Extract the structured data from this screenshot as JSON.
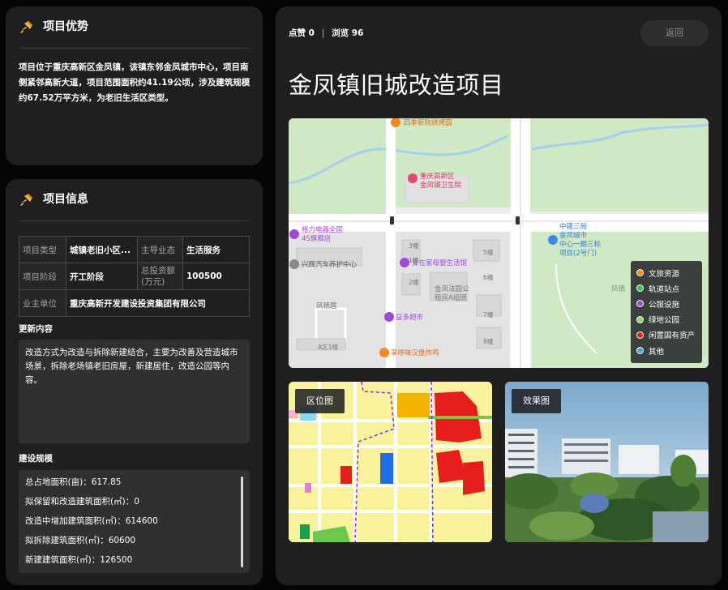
{
  "advantage": {
    "title": "项目优势",
    "text": "项目位于重庆高新区金凤镇，该镇东邻金凤城市中心，项目南侧紧邻高新大道，项目范围面积约41.19公顷，涉及建筑规模约67.52万平方米，为老旧生活区类型。"
  },
  "info": {
    "title": "项目信息",
    "type_label": "项目类型",
    "type_value": "城镇老旧小区...",
    "business_label": "主导业态",
    "business_value": "生活服务",
    "stage_label": "项目阶段",
    "stage_value": "开工阶段",
    "investment_label": "总投资额(万元)",
    "investment_value": "100500",
    "owner_label": "业主单位",
    "owner_value": "重庆高新开发建设投资集团有限公司",
    "content_label": "更新内容",
    "content_text": "改造方式为改造与拆除新建结合，主要为改善及营造城市场景，拆除老场镇老旧房屋，新建居住，改造公园等内容。",
    "scale_label": "建设规模",
    "scale_items": [
      "总占地面积(亩)：617.85",
      "拟保留和改造建筑面积(㎡)：0",
      "改造中增加建筑面积(㎡)：614600",
      "拟拆除建筑面积(㎡)：60600",
      "新建建筑面积(㎡)：126500"
    ]
  },
  "main": {
    "likes_label": "点赞",
    "likes": "0",
    "separator": "|",
    "views_label": "浏览",
    "views": "96",
    "back_label": "返回",
    "title": "金凤镇旧城改造项目"
  },
  "map": {
    "labels": {
      "top": "四季新院烧烤园",
      "hospital": "重庆高新区\n金凤镇卫生院",
      "store": "格力电器全国\n4S旗舰店",
      "metro": "中建三局\n金凤城市\n中心一期三标\n项目(2号门)",
      "auto": "兴辉汽车养护中心",
      "baby": "爱在家母婴生活馆",
      "side": "凤栖",
      "park": "金凤法园公\n租房A组团",
      "fengxi": "凤栖居",
      "super": "益多超市",
      "restaurant": "享哆味汉堡炸鸡",
      "b3": "3幢",
      "b5": "5幢",
      "b1": "1幢",
      "b2": "2幢",
      "b6": "6幢",
      "b7": "7幢",
      "b8": "8幢",
      "a1": "A区1幢"
    },
    "legend": [
      {
        "label": "文旅资源",
        "color": "#f28a1e"
      },
      {
        "label": "轨道站点",
        "color": "#3cc35a"
      },
      {
        "label": "公服设施",
        "color": "#a04ad8"
      },
      {
        "label": "绿地公园",
        "color": "#9ed55b"
      },
      {
        "label": "闲置国有资产",
        "color": "#e02323"
      },
      {
        "label": "其他",
        "color": "#4aa0e6"
      }
    ]
  },
  "thumbs": {
    "location_label": "区位图",
    "effect_label": "效果图"
  }
}
